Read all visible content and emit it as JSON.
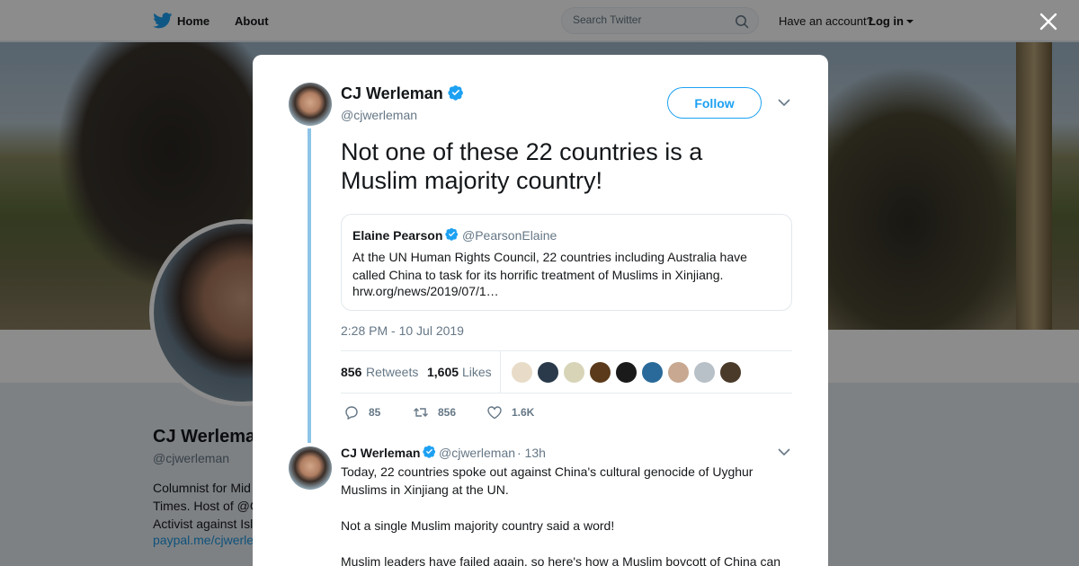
{
  "colors": {
    "brand": "#1da1f2",
    "text": "#14171a",
    "muted": "#657786",
    "thread_line": "#8ec4e8",
    "link": "#1b95e0"
  },
  "topbar": {
    "logo_icon": "twitter-bird-icon",
    "home_label": "Home",
    "about_label": "About",
    "search_placeholder": "Search Twitter",
    "search_icon": "search-icon",
    "have_account": "Have an account?",
    "login_label": "Log in"
  },
  "background_profile": {
    "name": "CJ Werlema",
    "handle": "@cjwerleman",
    "bio": "Columnist for Mid\nTimes. Host of @C\nActivist against Isl",
    "link": "paypal.me/cjwerle"
  },
  "close_icon": "close-x-icon",
  "tweet": {
    "author_name": "CJ Werleman",
    "author_handle": "@cjwerleman",
    "verified_icon": "verified-badge-icon",
    "follow_label": "Follow",
    "menu_icon": "chevron-down-icon",
    "text": "Not one of these 22 countries is a Muslim majority country!",
    "quoted": {
      "author_name": "Elaine Pearson",
      "author_handle": "@PearsonElaine",
      "text": "At the UN Human Rights Council, 22 countries including Australia have called China to task for its horrific treatment of Muslims in Xinjiang.",
      "link": "hrw.org/news/2019/07/1…"
    },
    "timestamp": "2:28 PM - 10 Jul 2019",
    "retweets_count": "856",
    "retweets_label": "Retweets",
    "likes_count": "1,605",
    "likes_label": "Likes",
    "liker_colors": [
      "#e8dcc8",
      "#2a3a4a",
      "#d8d4b8",
      "#5a3a1a",
      "#1a1a1a",
      "#2a6a9a",
      "#c8a890",
      "#b8c0c8",
      "#4a3a2a"
    ],
    "actions": {
      "reply_icon": "reply-icon",
      "reply_count": "85",
      "retweet_icon": "retweet-icon",
      "retweet_count": "856",
      "like_icon": "heart-icon",
      "like_count": "1.6K"
    }
  },
  "reply": {
    "author_name": "CJ Werleman",
    "author_handle": "@cjwerleman",
    "time": "· 13h",
    "paragraphs": [
      "Today, 22 countries spoke out against China's cultural genocide of Uyghur Muslims in Xinjiang at the UN.",
      "Not a single Muslim majority country said a word!",
      "Muslim leaders have failed again, so here's how a Muslim boycott of China can"
    ]
  }
}
